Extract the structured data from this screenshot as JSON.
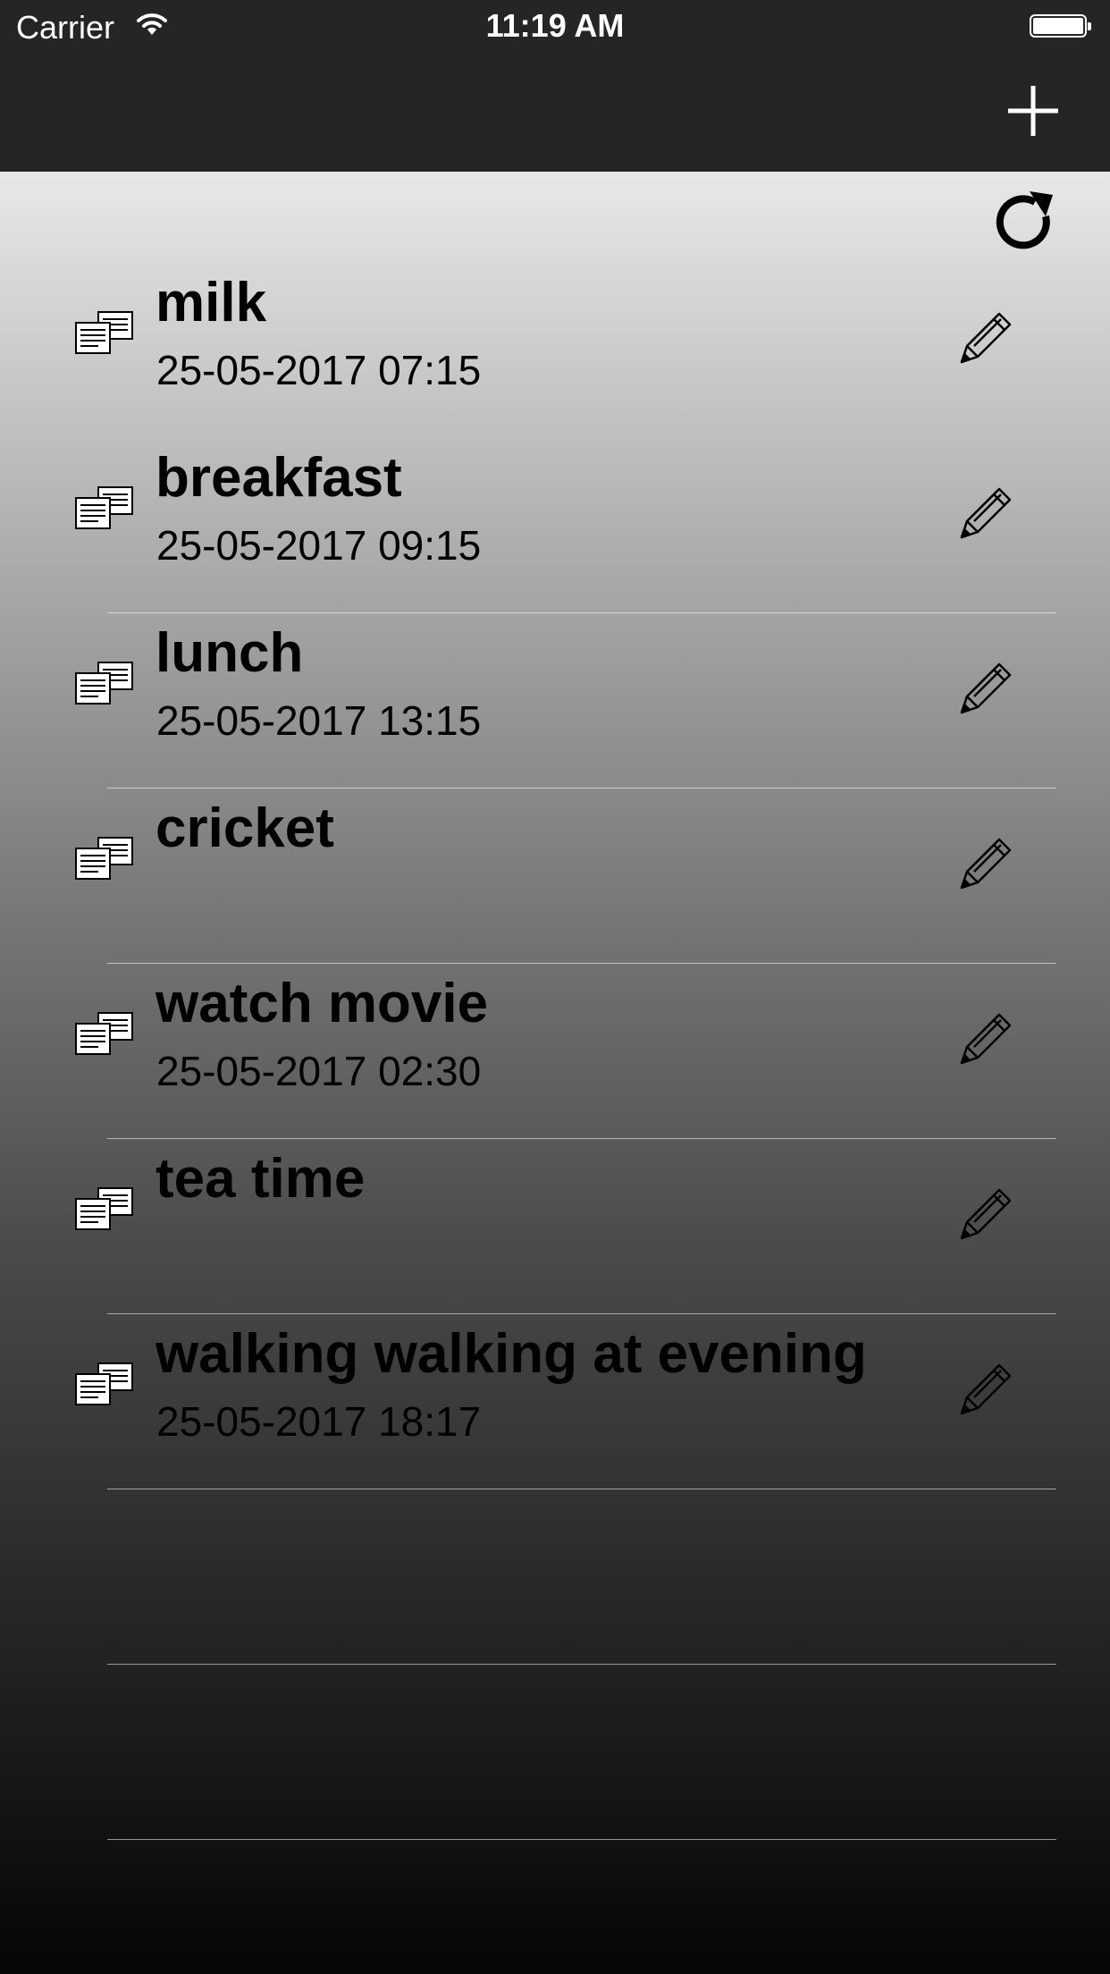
{
  "status_bar": {
    "carrier": "Carrier",
    "time": "11:19 AM",
    "icons": [
      "wifi-icon",
      "battery-icon"
    ]
  },
  "nav_bar": {
    "add_icon": "plus-icon"
  },
  "toolbar": {
    "refresh_icon": "refresh-icon"
  },
  "tasks": [
    {
      "title": "milk",
      "date": "25-05-2017 07:15"
    },
    {
      "title": "breakfast",
      "date": "25-05-2017 09:15"
    },
    {
      "title": "lunch",
      "date": "25-05-2017 13:15"
    },
    {
      "title": "cricket",
      "date": ""
    },
    {
      "title": "watch movie",
      "date": "25-05-2017 02:30"
    },
    {
      "title": "tea time",
      "date": ""
    },
    {
      "title": "walking walking at evening",
      "date": "25-05-2017 18:17"
    },
    {
      "title": "",
      "date": ""
    },
    {
      "title": "",
      "date": ""
    }
  ],
  "row_icons": {
    "leading": "notes-icon",
    "trailing": "pencil-icon"
  }
}
